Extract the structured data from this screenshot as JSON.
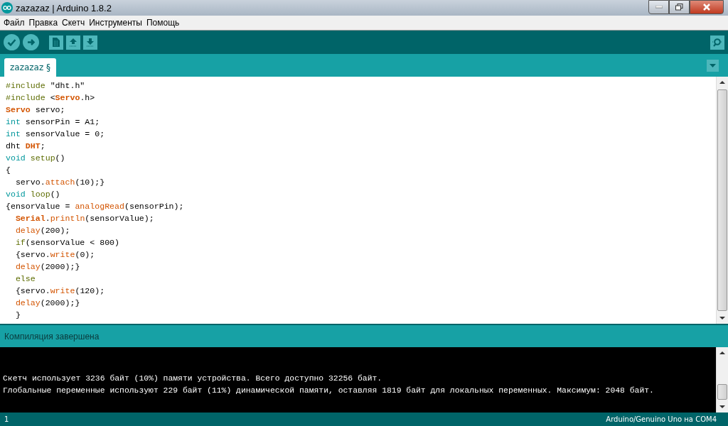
{
  "window": {
    "title": "zazazaz | Arduino 1.8.2"
  },
  "menu": [
    "Файл",
    "Правка",
    "Скетч",
    "Инструменты",
    "Помощь"
  ],
  "tabs": [
    {
      "label": "zazazaz §",
      "selected": true
    }
  ],
  "code": [
    [
      {
        "kind": "keyword",
        "text": "#include"
      },
      {
        "kind": "plain",
        "text": " \"dht.h\""
      }
    ],
    [
      {
        "kind": "keyword",
        "text": "#include"
      },
      {
        "kind": "plain",
        "text": " <"
      },
      {
        "kind": "class",
        "text": "Servo"
      },
      {
        "kind": "plain",
        "text": ".h>"
      }
    ],
    [
      {
        "kind": "class",
        "text": "Servo"
      },
      {
        "kind": "plain",
        "text": " servo;"
      }
    ],
    [
      {
        "kind": "type",
        "text": "int"
      },
      {
        "kind": "plain",
        "text": " sensorPin = A1;"
      }
    ],
    [
      {
        "kind": "type",
        "text": "int"
      },
      {
        "kind": "plain",
        "text": " sensorValue = 0;"
      }
    ],
    [
      {
        "kind": "plain",
        "text": "dht "
      },
      {
        "kind": "class",
        "text": "DHT"
      },
      {
        "kind": "plain",
        "text": ";"
      }
    ],
    [
      {
        "kind": "type",
        "text": "void"
      },
      {
        "kind": "keyword",
        "text": " setup"
      },
      {
        "kind": "plain",
        "text": "()"
      }
    ],
    [
      {
        "kind": "plain",
        "text": "{"
      }
    ],
    [
      {
        "kind": "plain",
        "text": "  servo."
      },
      {
        "kind": "function",
        "text": "attach"
      },
      {
        "kind": "plain",
        "text": "(10);}"
      }
    ],
    [
      {
        "kind": "type",
        "text": "void"
      },
      {
        "kind": "keyword",
        "text": " loop"
      },
      {
        "kind": "plain",
        "text": "()"
      }
    ],
    [
      {
        "kind": "plain",
        "text": "{ensorValue = "
      },
      {
        "kind": "function",
        "text": "analogRead"
      },
      {
        "kind": "plain",
        "text": "(sensorPin);"
      }
    ],
    [
      {
        "kind": "class",
        "text": "  Serial"
      },
      {
        "kind": "plain",
        "text": "."
      },
      {
        "kind": "function",
        "text": "println"
      },
      {
        "kind": "plain",
        "text": "(sensorValue);"
      }
    ],
    [
      {
        "kind": "function",
        "text": "  delay"
      },
      {
        "kind": "plain",
        "text": "(200);"
      }
    ],
    [
      {
        "kind": "keyword",
        "text": "  if"
      },
      {
        "kind": "plain",
        "text": "(sensorValue < 800)"
      }
    ],
    [
      {
        "kind": "plain",
        "text": "  {servo."
      },
      {
        "kind": "function",
        "text": "write"
      },
      {
        "kind": "plain",
        "text": "(0);"
      }
    ],
    [
      {
        "kind": "function",
        "text": "  delay"
      },
      {
        "kind": "plain",
        "text": "(2000);}"
      }
    ],
    [
      {
        "kind": "keyword",
        "text": "  else"
      }
    ],
    [
      {
        "kind": "plain",
        "text": "  {servo."
      },
      {
        "kind": "function",
        "text": "write"
      },
      {
        "kind": "plain",
        "text": "(120);"
      }
    ],
    [
      {
        "kind": "function",
        "text": "  delay"
      },
      {
        "kind": "plain",
        "text": "(2000);}"
      }
    ],
    [
      {
        "kind": "plain",
        "text": "  }"
      }
    ]
  ],
  "status_message": "Компиляция завершена",
  "console": [
    "Скетч использует 3236 байт (10%) памяти устройства. Всего доступно 32256 байт.",
    "Глобальные переменные используют 229 байт (11%) динамической памяти, оставляя 1819 байт для локальных переменных. Максимум: 2048 байт."
  ],
  "status_bar": {
    "line": "1",
    "board": "Arduino/Genuino Uno на COM4"
  }
}
